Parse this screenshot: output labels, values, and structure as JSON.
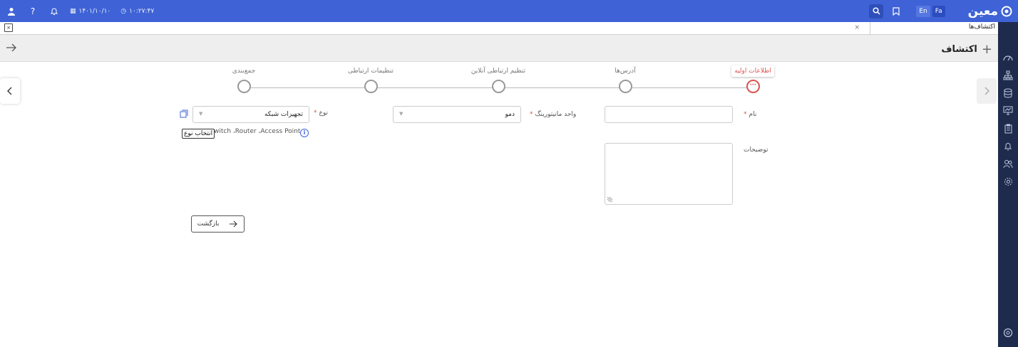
{
  "topbar": {
    "date": "۱۴۰۱/۱۰/۱۰",
    "time": "۱۰:۲۷:۴۷",
    "lang_en": "En",
    "lang_fa": "Fa",
    "logo_text": "معین"
  },
  "tabs": [
    {
      "label": "اکتشاف‌ها",
      "close": "×"
    }
  ],
  "tab_icon_text": "×",
  "header": {
    "title": "اکتشاف",
    "add_symbol": "+"
  },
  "steps": [
    {
      "label": "اطلاعات اولیه",
      "active": true
    },
    {
      "label": "آدرس‌ها",
      "active": false
    },
    {
      "label": "تنظیم ارتباطی آنلاین",
      "active": false
    },
    {
      "label": "تنظیمات ارتباطی",
      "active": false
    },
    {
      "label": "جمع‌بندی",
      "active": false
    }
  ],
  "form": {
    "name_label": "نام",
    "name_value": "",
    "required_mark": "*",
    "unit_label": "واحد مانیتورینگ",
    "unit_value": "دمو",
    "type_label": "نوع",
    "type_value": "تجهیزات شبکه",
    "type_hint": "witch ،Router ،Access Point",
    "type_tooltip": "انتخاب نوع",
    "desc_label": "توضیحات",
    "desc_value": ""
  },
  "buttons": {
    "back": "بازگشت"
  },
  "colors": {
    "primary": "#3f63d6",
    "sidebar": "#1f2b4d",
    "active_step": "#d9534f"
  }
}
